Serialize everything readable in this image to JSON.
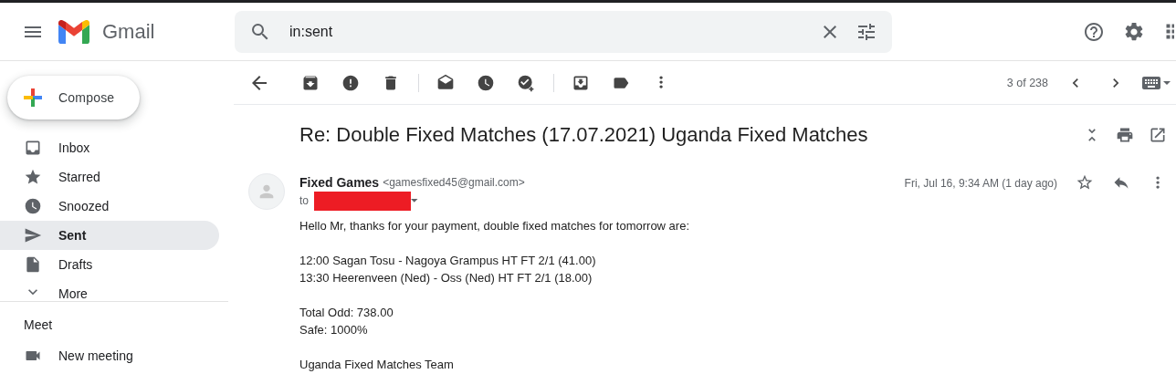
{
  "app": {
    "name": "Gmail"
  },
  "search": {
    "value": "in:sent"
  },
  "compose": {
    "label": "Compose"
  },
  "sidebar": {
    "items": [
      {
        "label": "Inbox",
        "selected": false
      },
      {
        "label": "Starred",
        "selected": false
      },
      {
        "label": "Snoozed",
        "selected": false
      },
      {
        "label": "Sent",
        "selected": true
      },
      {
        "label": "Drafts",
        "selected": false
      },
      {
        "label": "More",
        "selected": false
      }
    ]
  },
  "meet": {
    "title": "Meet",
    "items": [
      {
        "label": "New meeting"
      }
    ]
  },
  "toolbar": {
    "counter": "3 of 238"
  },
  "message": {
    "subject": "Re: Double Fixed Matches (17.07.2021) Uganda Fixed Matches",
    "sender_name": "Fixed Games",
    "sender_email": "<gamesfixed45@gmail.com>",
    "to_label": "to",
    "date": "Fri, Jul 16, 9:34 AM (1 day ago)",
    "starred": false,
    "body": [
      [
        "Hello Mr, thanks for your payment, double fixed matches for tomorrow are:"
      ],
      [
        "12:00 Sagan Tosu - Nagoya Grampus HT FT 2/1 (41.00)",
        "13:30 Heerenveen (Ned) - Oss (Ned) HT FT 2/1 (18.00)"
      ],
      [
        "Total Odd: 738.00",
        "Safe: 1000%"
      ],
      [
        "Uganda Fixed Matches Team"
      ]
    ]
  }
}
